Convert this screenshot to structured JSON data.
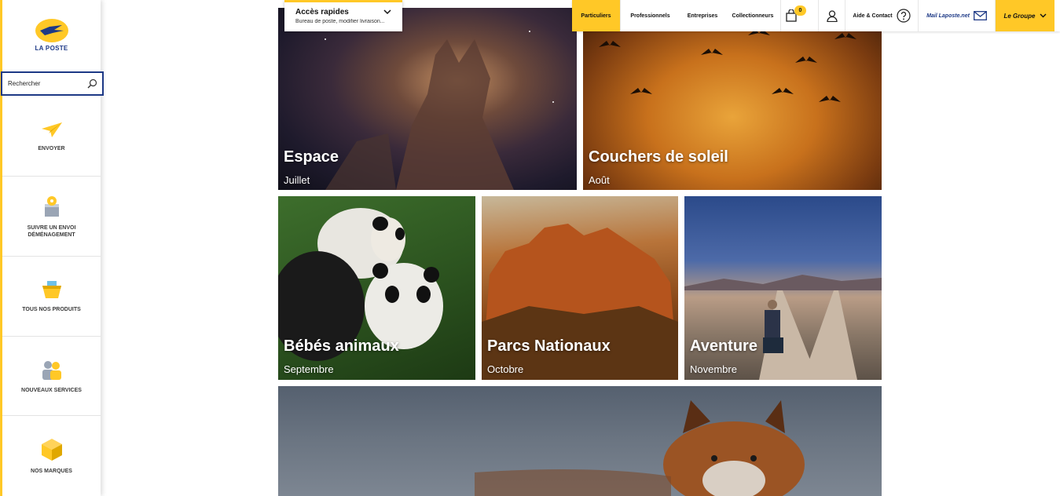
{
  "brand": {
    "name": "LA POSTE",
    "accent": "#ffc827",
    "navy": "#1d3986"
  },
  "search": {
    "placeholder": "Rechercher"
  },
  "sidebar": {
    "items": [
      {
        "label": "ENVOYER",
        "icon": "paper-plane-icon"
      },
      {
        "label": "SUIVRE UN ENVOI",
        "label2": "DÉMÉNAGEMENT",
        "icon": "tracking-box-icon"
      },
      {
        "label": "TOUS NOS PRODUITS",
        "icon": "basket-icon"
      },
      {
        "label": "NOUVEAUX SERVICES",
        "icon": "people-icon"
      },
      {
        "label": "NOS MARQUES",
        "icon": "package-icon"
      }
    ]
  },
  "quick_access": {
    "title": "Accès rapides",
    "subtitle": "Bureau de poste, modifier livraison..."
  },
  "topbar": {
    "tabs": [
      "Particuliers",
      "Professionnels",
      "Entreprises",
      "Collectionneurs"
    ],
    "cart_count": "0",
    "help": "Aide & Contact",
    "mail": "Mail Laposte.net",
    "group": "Le Groupe"
  },
  "tiles": [
    {
      "title": "Espace",
      "month": "Juillet"
    },
    {
      "title": "Couchers de soleil",
      "month": "Août"
    },
    {
      "title": "Bébés animaux",
      "month": "Septembre"
    },
    {
      "title": "Parcs Nationaux",
      "month": "Octobre"
    },
    {
      "title": "Aventure",
      "month": "Novembre"
    }
  ]
}
